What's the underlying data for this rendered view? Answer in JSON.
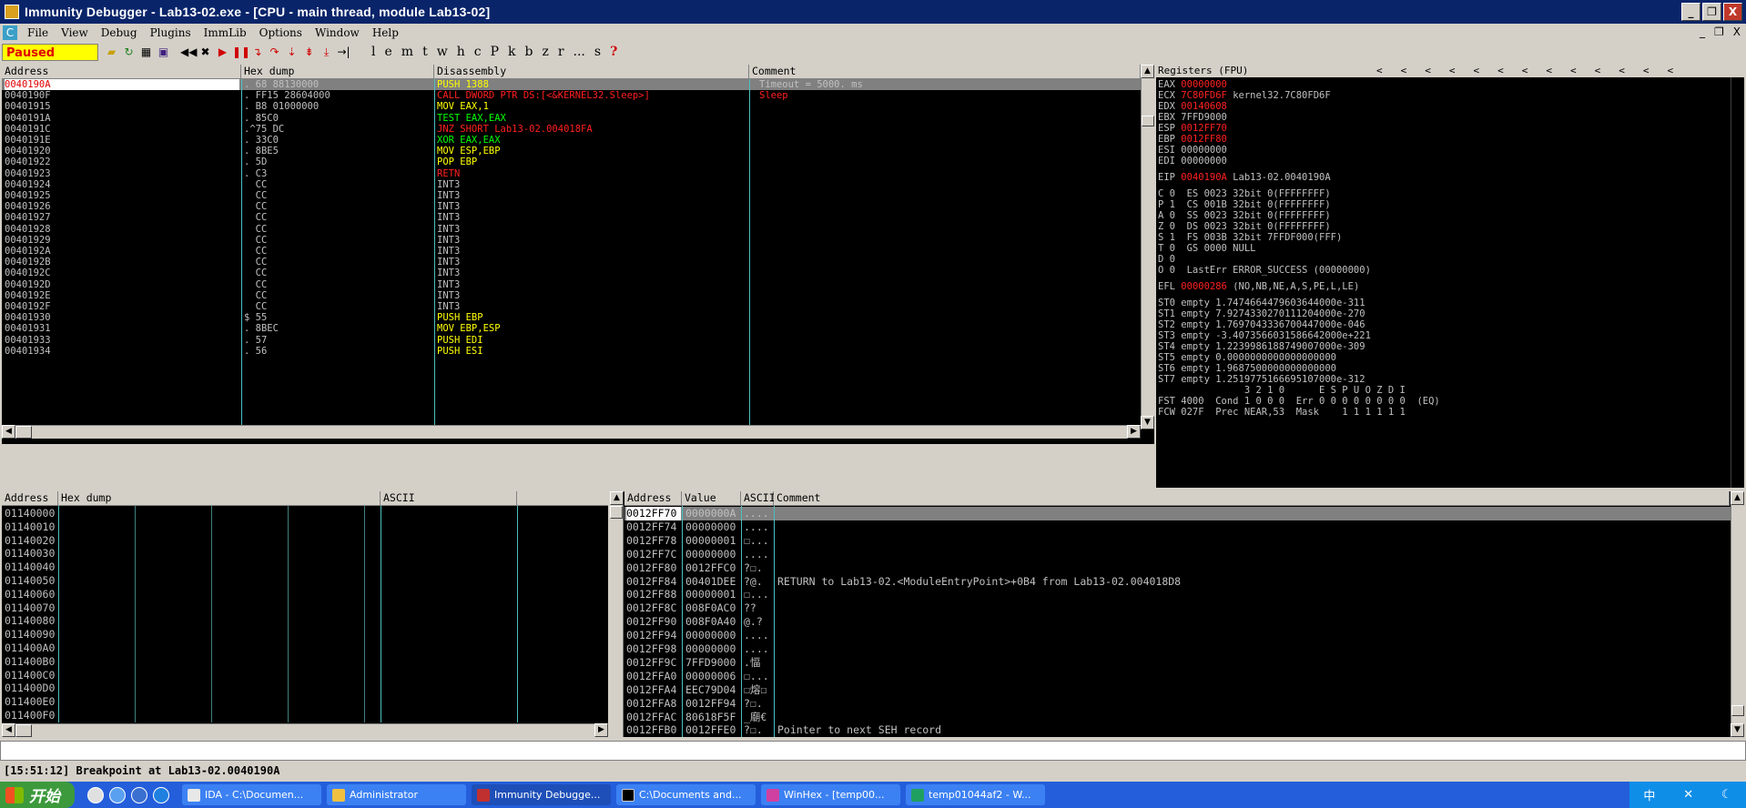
{
  "window": {
    "title": "Immunity Debugger - Lab13-02.exe - [CPU - main thread, module Lab13-02]",
    "btn_min": "_",
    "btn_restore": "❐",
    "btn_close": "X"
  },
  "menu": {
    "items": [
      "File",
      "View",
      "Debug",
      "Plugins",
      "ImmLib",
      "Options",
      "Window",
      "Help"
    ],
    "mdi_min": "_",
    "mdi_restore": "❐",
    "mdi_close": "X"
  },
  "toolbar": {
    "status": "Paused",
    "letters": [
      "l",
      "e",
      "m",
      "t",
      "w",
      "h",
      "c",
      "P",
      "k",
      "b",
      "z",
      "r",
      "...",
      "s",
      "?"
    ]
  },
  "cpu": {
    "headers": {
      "address": "Address",
      "hex": "Hex dump",
      "disasm": "Disassembly",
      "comment": "Comment"
    },
    "rows": [
      {
        "addr": "0040190A",
        "hex": ". 68 88130000",
        "dis": "PUSH 1388",
        "cmt": "Timeout = 5000. ms"
      },
      {
        "addr": "0040190F",
        "hex": ". FF15 28604000",
        "dis": "CALL DWORD PTR DS:[<&KERNEL32.Sleep>]",
        "cmt": "Sleep"
      },
      {
        "addr": "00401915",
        "hex": ". B8 01000000",
        "dis": "MOV EAX,1",
        "cmt": ""
      },
      {
        "addr": "0040191A",
        "hex": ". 85C0",
        "dis": "TEST EAX,EAX",
        "cmt": ""
      },
      {
        "addr": "0040191C",
        "hex": ".^75 DC",
        "dis": "JNZ SHORT Lab13-02.004018FA",
        "cmt": ""
      },
      {
        "addr": "0040191E",
        "hex": ". 33C0",
        "dis": "XOR EAX,EAX",
        "cmt": ""
      },
      {
        "addr": "00401920",
        "hex": ". 8BE5",
        "dis": "MOV ESP,EBP",
        "cmt": ""
      },
      {
        "addr": "00401922",
        "hex": ". 5D",
        "dis": "POP EBP",
        "cmt": ""
      },
      {
        "addr": "00401923",
        "hex": ". C3",
        "dis": "RETN",
        "cmt": ""
      },
      {
        "addr": "00401924",
        "hex": "  CC",
        "dis": "INT3",
        "cmt": ""
      },
      {
        "addr": "00401925",
        "hex": "  CC",
        "dis": "INT3",
        "cmt": ""
      },
      {
        "addr": "00401926",
        "hex": "  CC",
        "dis": "INT3",
        "cmt": ""
      },
      {
        "addr": "00401927",
        "hex": "  CC",
        "dis": "INT3",
        "cmt": ""
      },
      {
        "addr": "00401928",
        "hex": "  CC",
        "dis": "INT3",
        "cmt": ""
      },
      {
        "addr": "00401929",
        "hex": "  CC",
        "dis": "INT3",
        "cmt": ""
      },
      {
        "addr": "0040192A",
        "hex": "  CC",
        "dis": "INT3",
        "cmt": ""
      },
      {
        "addr": "0040192B",
        "hex": "  CC",
        "dis": "INT3",
        "cmt": ""
      },
      {
        "addr": "0040192C",
        "hex": "  CC",
        "dis": "INT3",
        "cmt": ""
      },
      {
        "addr": "0040192D",
        "hex": "  CC",
        "dis": "INT3",
        "cmt": ""
      },
      {
        "addr": "0040192E",
        "hex": "  CC",
        "dis": "INT3",
        "cmt": ""
      },
      {
        "addr": "0040192F",
        "hex": "  CC",
        "dis": "INT3",
        "cmt": ""
      },
      {
        "addr": "00401930",
        "hex": "$ 55",
        "dis": "PUSH EBP",
        "cmt": ""
      },
      {
        "addr": "00401931",
        "hex": ". 8BEC",
        "dis": "MOV EBP,ESP",
        "cmt": ""
      },
      {
        "addr": "00401933",
        "hex": ". 57",
        "dis": "PUSH EDI",
        "cmt": ""
      },
      {
        "addr": "00401934",
        "hex": ". 56",
        "dis": "PUSH ESI",
        "cmt": ""
      }
    ],
    "colors": {
      "push": "#ffff00",
      "call": "#ff2020",
      "mov": "#ffff00",
      "test": "#00ff00",
      "jmp": "#ff2020",
      "xor": "#00ff00",
      "pop": "#ffff00",
      "retn": "#ff2020",
      "int3": "#c0c0c0"
    }
  },
  "registers": {
    "title": "Registers (FPU)",
    "nav": [
      "<",
      "<",
      "<",
      "<",
      "<",
      "<",
      "<",
      "<",
      "<",
      "<",
      "<",
      "<",
      "<"
    ],
    "gp": [
      {
        "name": "EAX",
        "val": "00000000",
        "extra": "",
        "red": true
      },
      {
        "name": "ECX",
        "val": "7C80FD6F",
        "extra": "kernel32.7C80FD6F",
        "red": true
      },
      {
        "name": "EDX",
        "val": "00140608",
        "extra": "",
        "red": true
      },
      {
        "name": "EBX",
        "val": "7FFD9000",
        "extra": "",
        "red": false
      },
      {
        "name": "ESP",
        "val": "0012FF70",
        "extra": "",
        "red": true
      },
      {
        "name": "EBP",
        "val": "0012FF80",
        "extra": "",
        "red": true
      },
      {
        "name": "ESI",
        "val": "00000000",
        "extra": "",
        "red": false
      },
      {
        "name": "EDI",
        "val": "00000000",
        "extra": "",
        "red": false
      }
    ],
    "eip": {
      "name": "EIP",
      "val": "0040190A",
      "extra": "Lab13-02.0040190A"
    },
    "flags": [
      "C 0  ES 0023 32bit 0(FFFFFFFF)",
      "P 1  CS 001B 32bit 0(FFFFFFFF)",
      "A 0  SS 0023 32bit 0(FFFFFFFF)",
      "Z 0  DS 0023 32bit 0(FFFFFFFF)",
      "S 1  FS 003B 32bit 7FFDF000(FFF)",
      "T 0  GS 0000 NULL",
      "D 0",
      "O 0  LastErr ERROR_SUCCESS (00000000)"
    ],
    "efl": {
      "name": "EFL",
      "val": "00000286",
      "extra": "(NO,NB,NE,A,S,PE,L,LE)"
    },
    "fpu": [
      "ST0 empty 1.7474664479603644000e-311",
      "ST1 empty 7.9274330270111204000e-270",
      "ST2 empty 1.7697043336700447000e-046",
      "ST3 empty -3.4073566031586642000e+221",
      "ST4 empty 1.2239986188749007000e-309",
      "ST5 empty 0.0000000000000000000",
      "ST6 empty 1.9687500000000000000",
      "ST7 empty 1.2519775166695107000e-312"
    ],
    "fst_hdr": "               3 2 1 0      E S P U O Z D I",
    "fst": "FST 4000  Cond 1 0 0 0  Err 0 0 0 0 0 0 0 0  (EQ)",
    "fcw": "FCW 027F  Prec NEAR,53  Mask    1 1 1 1 1 1"
  },
  "dump": {
    "headers": {
      "address": "Address",
      "hex": "Hex dump",
      "ascii": "ASCII"
    },
    "rows": [
      "01140000",
      "01140010",
      "01140020",
      "01140030",
      "01140040",
      "01140050",
      "01140060",
      "01140070",
      "01140080",
      "01140090",
      "011400A0",
      "011400B0",
      "011400C0",
      "011400D0",
      "011400E0",
      "011400F0"
    ]
  },
  "stack": {
    "headers": {
      "address": "Address",
      "value": "Value",
      "ascii": "ASCII",
      "comment": "Comment"
    },
    "rows": [
      {
        "addr": "0012FF70",
        "val": "0000000A",
        "asc": "....",
        "cmt": ""
      },
      {
        "addr": "0012FF74",
        "val": "00000000",
        "asc": "....",
        "cmt": ""
      },
      {
        "addr": "0012FF78",
        "val": "00000001",
        "asc": "☐...",
        "cmt": ""
      },
      {
        "addr": "0012FF7C",
        "val": "00000000",
        "asc": "....",
        "cmt": ""
      },
      {
        "addr": "0012FF80",
        "val": "0012FFC0",
        "asc": "?☐.",
        "cmt": ""
      },
      {
        "addr": "0012FF84",
        "val": "00401DEE",
        "asc": "?@.",
        "cmt": "RETURN to Lab13-02.<ModuleEntryPoint>+0B4 from Lab13-02.004018D8"
      },
      {
        "addr": "0012FF88",
        "val": "00000001",
        "asc": "☐...",
        "cmt": ""
      },
      {
        "addr": "0012FF8C",
        "val": "008F0AC0",
        "asc": "??",
        "cmt": ""
      },
      {
        "addr": "0012FF90",
        "val": "008F0A40",
        "asc": "@.?",
        "cmt": ""
      },
      {
        "addr": "0012FF94",
        "val": "00000000",
        "asc": "....",
        "cmt": ""
      },
      {
        "addr": "0012FF98",
        "val": "00000000",
        "asc": "....",
        "cmt": ""
      },
      {
        "addr": "0012FF9C",
        "val": "7FFD9000",
        "asc": ".愊",
        "cmt": ""
      },
      {
        "addr": "0012FFA0",
        "val": "00000006",
        "asc": "☐...",
        "cmt": ""
      },
      {
        "addr": "0012FFA4",
        "val": "EEC79D04",
        "asc": "☐熔☐",
        "cmt": ""
      },
      {
        "addr": "0012FFA8",
        "val": "0012FF94",
        "asc": "?☐.",
        "cmt": ""
      },
      {
        "addr": "0012FFAC",
        "val": "80618F5F",
        "asc": "_廟€",
        "cmt": ""
      },
      {
        "addr": "0012FFB0",
        "val": "0012FFE0",
        "asc": "?☐.",
        "cmt": "Pointer to next SEH record"
      }
    ]
  },
  "status": "[15:51:12] Breakpoint at Lab13-02.0040190A",
  "taskbar": {
    "start": "开始",
    "tasks": [
      "IDA - C:\\Documen...",
      "Administrator",
      "Immunity Debugge...",
      "C:\\Documents and...",
      "WinHex - [temp00...",
      "temp01044af2 - W..."
    ],
    "tray": [
      "中",
      "✕",
      "☾"
    ]
  }
}
